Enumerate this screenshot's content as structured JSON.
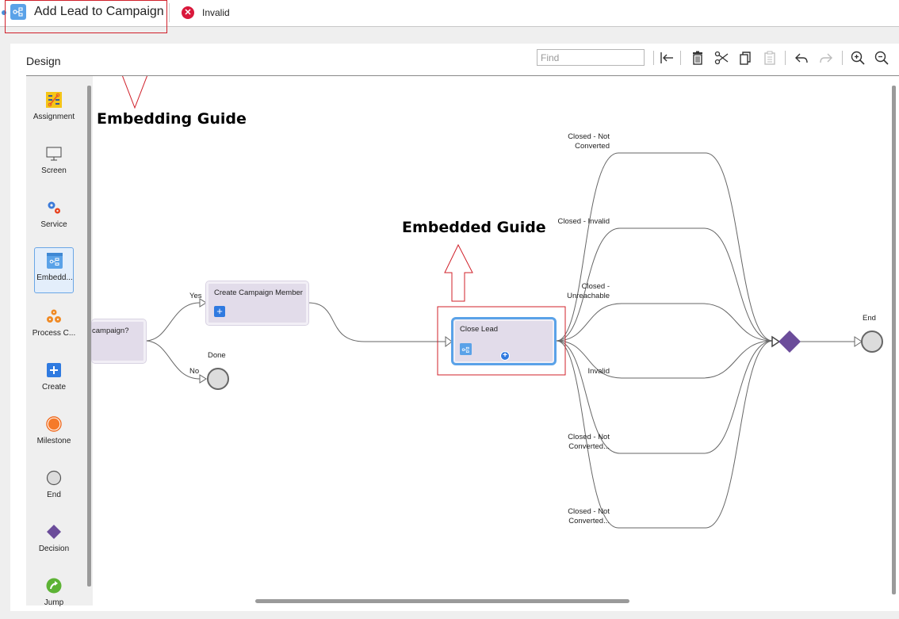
{
  "header": {
    "title": "Add Lead to Campaign",
    "status": "Invalid",
    "status_color": "#d9183b"
  },
  "panel": {
    "title": "Design",
    "find": {
      "value": "",
      "placeholder": "Find"
    },
    "toolbar": [
      {
        "name": "collapse-left",
        "icon": "arrow-to-left-icon"
      },
      {
        "name": "delete",
        "icon": "trash-icon"
      },
      {
        "name": "cut",
        "icon": "scissors-icon"
      },
      {
        "name": "copy",
        "icon": "copy-icon"
      },
      {
        "name": "paste",
        "icon": "clipboard-icon",
        "disabled": true
      },
      {
        "name": "undo",
        "icon": "undo-icon"
      },
      {
        "name": "redo",
        "icon": "redo-icon",
        "disabled": true
      },
      {
        "name": "zoom-in",
        "icon": "zoom-in-icon"
      },
      {
        "name": "zoom-out",
        "icon": "zoom-out-icon"
      }
    ]
  },
  "palette": {
    "items": [
      {
        "label": "Assignment",
        "icon": "assignment-icon"
      },
      {
        "label": "Screen",
        "icon": "monitor-icon"
      },
      {
        "label": "Service",
        "icon": "gears-icon"
      },
      {
        "label": "Embedd...",
        "icon": "embedded-flow-icon",
        "selected": true
      },
      {
        "label": "Process C...",
        "icon": "process-call-icon"
      },
      {
        "label": "Create",
        "icon": "plus-icon"
      },
      {
        "label": "Milestone",
        "icon": "milestone-icon"
      },
      {
        "label": "End",
        "icon": "end-circle-icon"
      },
      {
        "label": "Decision",
        "icon": "diamond-icon"
      },
      {
        "label": "Jump",
        "icon": "jump-arrow-icon"
      }
    ]
  },
  "canvas": {
    "decision_node": {
      "title": "campaign?"
    },
    "create_member_node": {
      "title": "Create Campaign Member"
    },
    "close_lead_node": {
      "title": "Close Lead"
    },
    "done_label": "Done",
    "end_label": "End",
    "edge_yes": "Yes",
    "edge_no": "No",
    "branches": [
      {
        "line1": "Closed - Not",
        "line2": "Converted"
      },
      {
        "line1": "Closed - Invalid",
        "line2": ""
      },
      {
        "line1": "Closed -",
        "line2": "Unreachable"
      },
      {
        "line1": "Invalid",
        "line2": ""
      },
      {
        "line1": "Closed - Not",
        "line2": "Converted..."
      },
      {
        "line1": "Closed - Not",
        "line2": "Converted..."
      }
    ]
  },
  "annotations": {
    "embedding": "Embedding Guide",
    "embedded": "Embedded Guide",
    "color": "#d0202a"
  }
}
